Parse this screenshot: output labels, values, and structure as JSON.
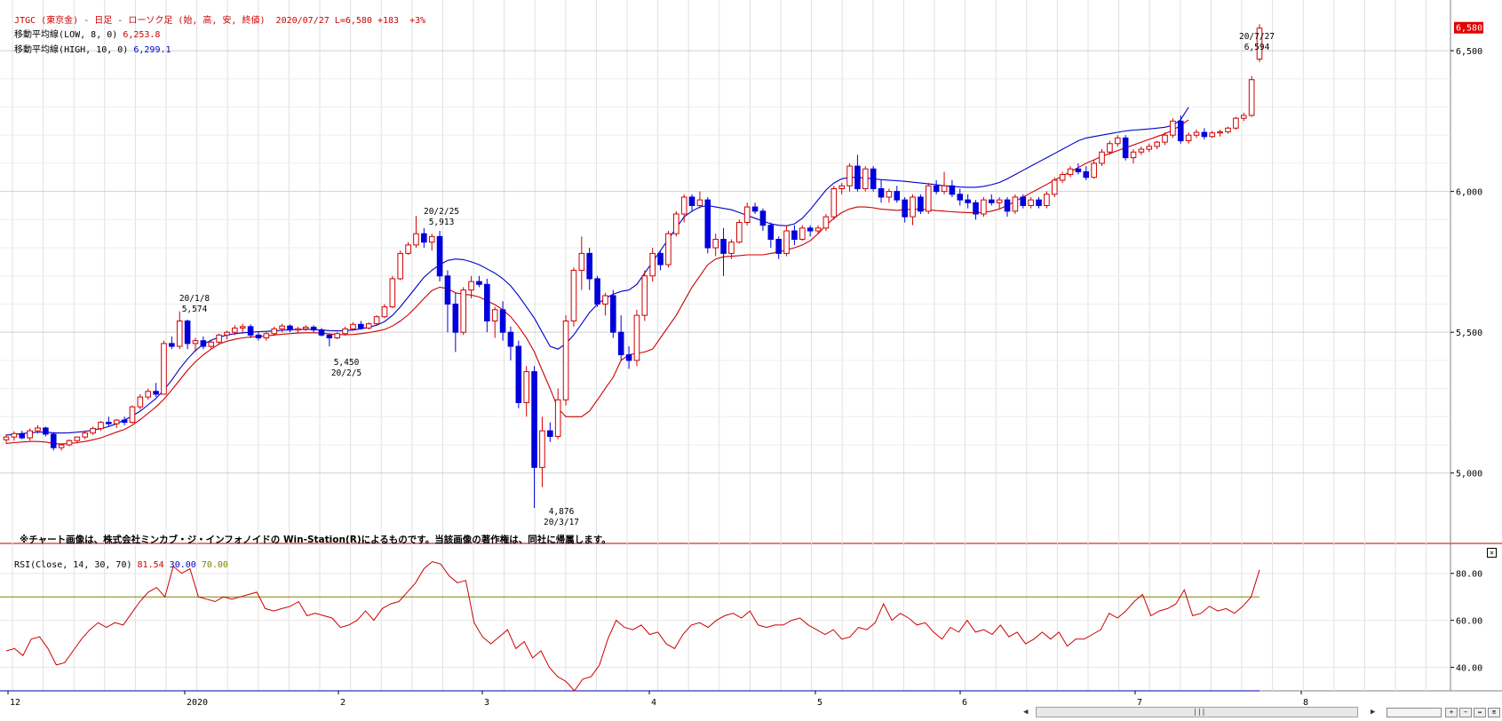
{
  "header": {
    "title": "JTGC (東京金) - 日足 - ローソク足 (始, 高, 安, 終値)",
    "date": "2020/07/27",
    "last": "L=6,580",
    "change": "+183",
    "pct": "+3%",
    "ma_low_label": "移動平均線(LOW, 8, 0)",
    "ma_low_value": "6,253.8",
    "ma_high_label": "移動平均線(HIGH, 10, 0)",
    "ma_high_value": "6,299.1"
  },
  "notice": "※チャート画像は、株式会社ミンカブ・ジ・インフォノイドの Win-Station(R)によるものです。当該画像の著作権は、同社に帰属します。",
  "rsi_header": {
    "label": "RSI(Close, 14, 30, 70)",
    "value": "81.54",
    "low": "30.00",
    "high": "70.00"
  },
  "colors": {
    "up": "#d00000",
    "down": "#0000dd",
    "ma_low": "#cc0000",
    "ma_high": "#0000cc",
    "rsi": "#cc0000",
    "rsi_hi": "#808000",
    "rsi_lo": "#0000aa"
  },
  "icons": {
    "close": "close-icon",
    "scroll": "scroll-grip-icon"
  },
  "chart_data": {
    "type": "candlestick",
    "ylim": [
      4750,
      6680
    ],
    "price_ticks": [
      "6,500",
      "6,000",
      "5,500",
      "5,000"
    ],
    "last_price_label": "6,580",
    "x_labels": [
      "12",
      "2020",
      "2",
      "3",
      "4",
      "5",
      "6",
      "7",
      "8"
    ],
    "annotations": [
      {
        "date": "20/1/8",
        "value": "5,574"
      },
      {
        "date": "20/2/5",
        "value": "5,450"
      },
      {
        "date": "20/2/25",
        "value": "5,913"
      },
      {
        "date": "20/3/17",
        "value": "4,876"
      },
      {
        "date": "20/7/27",
        "value": "6,594"
      }
    ],
    "ohlc": [
      [
        5118,
        5138,
        5105,
        5128
      ],
      [
        5128,
        5148,
        5115,
        5140
      ],
      [
        5140,
        5150,
        5120,
        5125
      ],
      [
        5125,
        5158,
        5115,
        5150
      ],
      [
        5150,
        5170,
        5140,
        5160
      ],
      [
        5160,
        5165,
        5130,
        5138
      ],
      [
        5138,
        5145,
        5080,
        5090
      ],
      [
        5090,
        5105,
        5080,
        5100
      ],
      [
        5100,
        5120,
        5095,
        5115
      ],
      [
        5115,
        5130,
        5105,
        5128
      ],
      [
        5128,
        5150,
        5120,
        5142
      ],
      [
        5142,
        5165,
        5135,
        5158
      ],
      [
        5158,
        5185,
        5150,
        5180
      ],
      [
        5180,
        5200,
        5165,
        5175
      ],
      [
        5175,
        5192,
        5160,
        5188
      ],
      [
        5188,
        5200,
        5170,
        5180
      ],
      [
        5180,
        5240,
        5175,
        5235
      ],
      [
        5235,
        5280,
        5225,
        5270
      ],
      [
        5270,
        5300,
        5260,
        5290
      ],
      [
        5290,
        5320,
        5270,
        5280
      ],
      [
        5280,
        5470,
        5280,
        5460
      ],
      [
        5460,
        5485,
        5440,
        5450
      ],
      [
        5450,
        5574,
        5440,
        5540
      ],
      [
        5540,
        5545,
        5440,
        5460
      ],
      [
        5460,
        5480,
        5430,
        5470
      ],
      [
        5470,
        5485,
        5440,
        5450
      ],
      [
        5450,
        5470,
        5440,
        5465
      ],
      [
        5465,
        5495,
        5455,
        5490
      ],
      [
        5490,
        5505,
        5475,
        5500
      ],
      [
        5500,
        5525,
        5490,
        5515
      ],
      [
        5515,
        5530,
        5495,
        5520
      ],
      [
        5520,
        5528,
        5480,
        5490
      ],
      [
        5490,
        5500,
        5470,
        5480
      ],
      [
        5480,
        5500,
        5470,
        5495
      ],
      [
        5495,
        5520,
        5488,
        5512
      ],
      [
        5512,
        5530,
        5500,
        5522
      ],
      [
        5522,
        5528,
        5500,
        5508
      ],
      [
        5508,
        5520,
        5495,
        5512
      ],
      [
        5512,
        5525,
        5505,
        5518
      ],
      [
        5518,
        5525,
        5500,
        5508
      ],
      [
        5508,
        5515,
        5485,
        5490
      ],
      [
        5490,
        5495,
        5450,
        5480
      ],
      [
        5480,
        5500,
        5475,
        5495
      ],
      [
        5495,
        5520,
        5488,
        5512
      ],
      [
        5512,
        5535,
        5505,
        5528
      ],
      [
        5528,
        5540,
        5510,
        5515
      ],
      [
        5515,
        5535,
        5510,
        5530
      ],
      [
        5530,
        5560,
        5525,
        5555
      ],
      [
        5555,
        5600,
        5550,
        5590
      ],
      [
        5590,
        5700,
        5585,
        5690
      ],
      [
        5690,
        5790,
        5685,
        5780
      ],
      [
        5780,
        5820,
        5775,
        5810
      ],
      [
        5810,
        5913,
        5800,
        5850
      ],
      [
        5850,
        5870,
        5800,
        5820
      ],
      [
        5820,
        5850,
        5790,
        5840
      ],
      [
        5840,
        5860,
        5680,
        5700
      ],
      [
        5700,
        5720,
        5500,
        5600
      ],
      [
        5600,
        5640,
        5430,
        5500
      ],
      [
        5500,
        5660,
        5490,
        5650
      ],
      [
        5650,
        5700,
        5620,
        5680
      ],
      [
        5680,
        5700,
        5660,
        5670
      ],
      [
        5670,
        5690,
        5500,
        5540
      ],
      [
        5540,
        5590,
        5480,
        5580
      ],
      [
        5580,
        5610,
        5470,
        5500
      ],
      [
        5500,
        5520,
        5400,
        5450
      ],
      [
        5450,
        5470,
        5230,
        5250
      ],
      [
        5250,
        5380,
        5200,
        5360
      ],
      [
        5360,
        5380,
        4876,
        5020
      ],
      [
        5020,
        5200,
        4950,
        5150
      ],
      [
        5150,
        5180,
        5110,
        5130
      ],
      [
        5130,
        5300,
        5120,
        5260
      ],
      [
        5260,
        5560,
        5240,
        5540
      ],
      [
        5540,
        5730,
        5520,
        5720
      ],
      [
        5720,
        5840,
        5650,
        5780
      ],
      [
        5780,
        5800,
        5650,
        5690
      ],
      [
        5690,
        5700,
        5590,
        5600
      ],
      [
        5600,
        5640,
        5560,
        5630
      ],
      [
        5630,
        5650,
        5480,
        5500
      ],
      [
        5500,
        5560,
        5400,
        5420
      ],
      [
        5420,
        5450,
        5370,
        5400
      ],
      [
        5400,
        5580,
        5380,
        5560
      ],
      [
        5560,
        5720,
        5540,
        5700
      ],
      [
        5700,
        5800,
        5680,
        5780
      ],
      [
        5780,
        5790,
        5720,
        5740
      ],
      [
        5740,
        5860,
        5730,
        5850
      ],
      [
        5850,
        5930,
        5840,
        5920
      ],
      [
        5920,
        5990,
        5890,
        5980
      ],
      [
        5980,
        5990,
        5930,
        5950
      ],
      [
        5950,
        6000,
        5940,
        5970
      ],
      [
        5970,
        5980,
        5780,
        5800
      ],
      [
        5800,
        5850,
        5770,
        5830
      ],
      [
        5830,
        5870,
        5700,
        5780
      ],
      [
        5780,
        5830,
        5760,
        5820
      ],
      [
        5820,
        5900,
        5815,
        5890
      ],
      [
        5890,
        5960,
        5880,
        5945
      ],
      [
        5945,
        5960,
        5920,
        5930
      ],
      [
        5930,
        5940,
        5860,
        5880
      ],
      [
        5880,
        5890,
        5800,
        5830
      ],
      [
        5830,
        5840,
        5760,
        5780
      ],
      [
        5780,
        5880,
        5770,
        5860
      ],
      [
        5860,
        5880,
        5810,
        5830
      ],
      [
        5830,
        5880,
        5825,
        5870
      ],
      [
        5870,
        5880,
        5840,
        5860
      ],
      [
        5860,
        5880,
        5850,
        5870
      ],
      [
        5870,
        5920,
        5860,
        5910
      ],
      [
        5910,
        6020,
        5900,
        6010
      ],
      [
        6010,
        6030,
        5990,
        6020
      ],
      [
        6020,
        6100,
        6000,
        6090
      ],
      [
        6090,
        6130,
        6000,
        6010
      ],
      [
        6010,
        6090,
        6000,
        6080
      ],
      [
        6080,
        6090,
        6000,
        6010
      ],
      [
        6010,
        6040,
        5960,
        5980
      ],
      [
        5980,
        6010,
        5960,
        6000
      ],
      [
        6000,
        6020,
        5960,
        5970
      ],
      [
        5970,
        5980,
        5890,
        5910
      ],
      [
        5910,
        5990,
        5880,
        5980
      ],
      [
        5980,
        5990,
        5920,
        5930
      ],
      [
        5930,
        6030,
        5920,
        6020
      ],
      [
        6020,
        6040,
        5990,
        6000
      ],
      [
        6000,
        6070,
        5990,
        6020
      ],
      [
        6020,
        6040,
        5980,
        5990
      ],
      [
        5990,
        6010,
        5950,
        5970
      ],
      [
        5970,
        5990,
        5940,
        5960
      ],
      [
        5960,
        5970,
        5900,
        5920
      ],
      [
        5920,
        5980,
        5910,
        5970
      ],
      [
        5970,
        5990,
        5950,
        5960
      ],
      [
        5960,
        5980,
        5940,
        5970
      ],
      [
        5970,
        5980,
        5910,
        5930
      ],
      [
        5930,
        5990,
        5920,
        5980
      ],
      [
        5980,
        5990,
        5940,
        5950
      ],
      [
        5950,
        5980,
        5940,
        5970
      ],
      [
        5970,
        5980,
        5940,
        5950
      ],
      [
        5950,
        6000,
        5940,
        5990
      ],
      [
        5990,
        6050,
        5980,
        6040
      ],
      [
        6040,
        6070,
        6030,
        6060
      ],
      [
        6060,
        6090,
        6050,
        6080
      ],
      [
        6080,
        6100,
        6060,
        6070
      ],
      [
        6070,
        6090,
        6040,
        6050
      ],
      [
        6050,
        6110,
        6045,
        6100
      ],
      [
        6100,
        6150,
        6090,
        6140
      ],
      [
        6140,
        6180,
        6130,
        6170
      ],
      [
        6170,
        6200,
        6160,
        6190
      ],
      [
        6190,
        6200,
        6110,
        6120
      ],
      [
        6120,
        6150,
        6100,
        6140
      ],
      [
        6140,
        6160,
        6130,
        6150
      ],
      [
        6150,
        6170,
        6140,
        6160
      ],
      [
        6160,
        6180,
        6150,
        6175
      ],
      [
        6175,
        6210,
        6165,
        6200
      ],
      [
        6200,
        6260,
        6190,
        6250
      ],
      [
        6250,
        6270,
        6170,
        6180
      ],
      [
        6180,
        6210,
        6170,
        6200
      ],
      [
        6200,
        6220,
        6190,
        6210
      ],
      [
        6210,
        6225,
        6185,
        6195
      ],
      [
        6195,
        6215,
        6190,
        6208
      ],
      [
        6208,
        6220,
        6195,
        6212
      ],
      [
        6212,
        6230,
        6205,
        6225
      ],
      [
        6225,
        6265,
        6220,
        6260
      ],
      [
        6260,
        6280,
        6250,
        6270
      ],
      [
        6270,
        6410,
        6265,
        6397
      ],
      [
        6470,
        6594,
        6460,
        6580
      ]
    ],
    "ma_low_series": [
      5105,
      5108,
      5110,
      5112,
      5112,
      5110,
      5105,
      5103,
      5105,
      5108,
      5112,
      5118,
      5125,
      5135,
      5145,
      5155,
      5170,
      5190,
      5212,
      5235,
      5262,
      5295,
      5330,
      5365,
      5395,
      5420,
      5440,
      5458,
      5468,
      5475,
      5480,
      5483,
      5485,
      5487,
      5490,
      5493,
      5495,
      5497,
      5498,
      5498,
      5497,
      5494,
      5492,
      5491,
      5492,
      5495,
      5499,
      5504,
      5510,
      5522,
      5540,
      5562,
      5590,
      5620,
      5648,
      5660,
      5655,
      5640,
      5635,
      5632,
      5625,
      5612,
      5598,
      5580,
      5555,
      5520,
      5480,
      5430,
      5365,
      5300,
      5230,
      5200,
      5200,
      5200,
      5220,
      5260,
      5300,
      5340,
      5400,
      5420,
      5425,
      5430,
      5440,
      5480,
      5520,
      5560,
      5610,
      5660,
      5700,
      5740,
      5760,
      5768,
      5770,
      5772,
      5775,
      5775,
      5775,
      5780,
      5785,
      5792,
      5800,
      5810,
      5825,
      5850,
      5880,
      5905,
      5925,
      5938,
      5945,
      5945,
      5942,
      5937,
      5935,
      5933,
      5935,
      5937,
      5937,
      5935,
      5932,
      5930,
      5928,
      5926,
      5925,
      5924,
      5926,
      5930,
      5938,
      5950,
      5965,
      5980,
      5995,
      6010,
      6025,
      6040,
      6055,
      6070,
      6085,
      6100,
      6112,
      6125,
      6135,
      6145,
      6155,
      6165,
      6175,
      6185,
      6195,
      6205,
      6218,
      6235,
      6254
    ],
    "ma_high_series": [
      5135,
      5137,
      5140,
      5143,
      5145,
      5145,
      5143,
      5142,
      5143,
      5145,
      5148,
      5152,
      5158,
      5165,
      5175,
      5188,
      5203,
      5220,
      5242,
      5265,
      5295,
      5330,
      5370,
      5405,
      5435,
      5457,
      5472,
      5482,
      5490,
      5495,
      5498,
      5500,
      5502,
      5503,
      5505,
      5507,
      5509,
      5510,
      5510,
      5510,
      5508,
      5506,
      5505,
      5506,
      5508,
      5512,
      5518,
      5525,
      5538,
      5560,
      5590,
      5625,
      5660,
      5695,
      5720,
      5740,
      5755,
      5760,
      5758,
      5750,
      5740,
      5725,
      5710,
      5690,
      5665,
      5630,
      5590,
      5550,
      5500,
      5450,
      5440,
      5460,
      5490,
      5530,
      5570,
      5600,
      5620,
      5635,
      5645,
      5650,
      5670,
      5710,
      5750,
      5790,
      5830,
      5870,
      5910,
      5930,
      5945,
      5950,
      5945,
      5940,
      5935,
      5925,
      5915,
      5905,
      5895,
      5885,
      5880,
      5878,
      5885,
      5905,
      5935,
      5970,
      6005,
      6030,
      6045,
      6050,
      6050,
      6048,
      6045,
      6042,
      6040,
      6038,
      6036,
      6033,
      6030,
      6027,
      6024,
      6020,
      6018,
      6016,
      6015,
      6015,
      6018,
      6024,
      6032,
      6045,
      6060,
      6075,
      6090,
      6105,
      6120,
      6135,
      6150,
      6165,
      6180,
      6190,
      6195,
      6200,
      6205,
      6210,
      6215,
      6218,
      6220,
      6222,
      6225,
      6228,
      6235,
      6255,
      6299
    ],
    "rsi": {
      "ylim": [
        30,
        92
      ],
      "ticks": [
        "80.00",
        "60.00",
        "40.00"
      ],
      "levels": [
        30,
        70
      ],
      "values": [
        47,
        48,
        45,
        52,
        53,
        48,
        41,
        42,
        47,
        52,
        56,
        59,
        57,
        59,
        58,
        63,
        68,
        72,
        74,
        70,
        83,
        80,
        82,
        70,
        69,
        68,
        70,
        69,
        70,
        71,
        72,
        65,
        64,
        65,
        66,
        68,
        62,
        63,
        62,
        61,
        57,
        58,
        60,
        64,
        60,
        65,
        67,
        68,
        72,
        76,
        82,
        85,
        84,
        79,
        76,
        77,
        59,
        53,
        50,
        53,
        56,
        48,
        51,
        44,
        47,
        40,
        36,
        34,
        30,
        35,
        36,
        41,
        52,
        60,
        57,
        56,
        58,
        54,
        55,
        50,
        48,
        54,
        58,
        59,
        57,
        60,
        62,
        63,
        61,
        64,
        58,
        57,
        58,
        58,
        60,
        61,
        58,
        56,
        54,
        56,
        52,
        53,
        57,
        56,
        59,
        67,
        60,
        63,
        61,
        58,
        59,
        55,
        52,
        57,
        55,
        60,
        55,
        56,
        54,
        58,
        53,
        55,
        50,
        52,
        55,
        52,
        55,
        49,
        52,
        52,
        54,
        56,
        63,
        61,
        64,
        68,
        71,
        62,
        64,
        65,
        67,
        73,
        62,
        63,
        66,
        64,
        65,
        63,
        66,
        70,
        81.54
      ]
    }
  }
}
